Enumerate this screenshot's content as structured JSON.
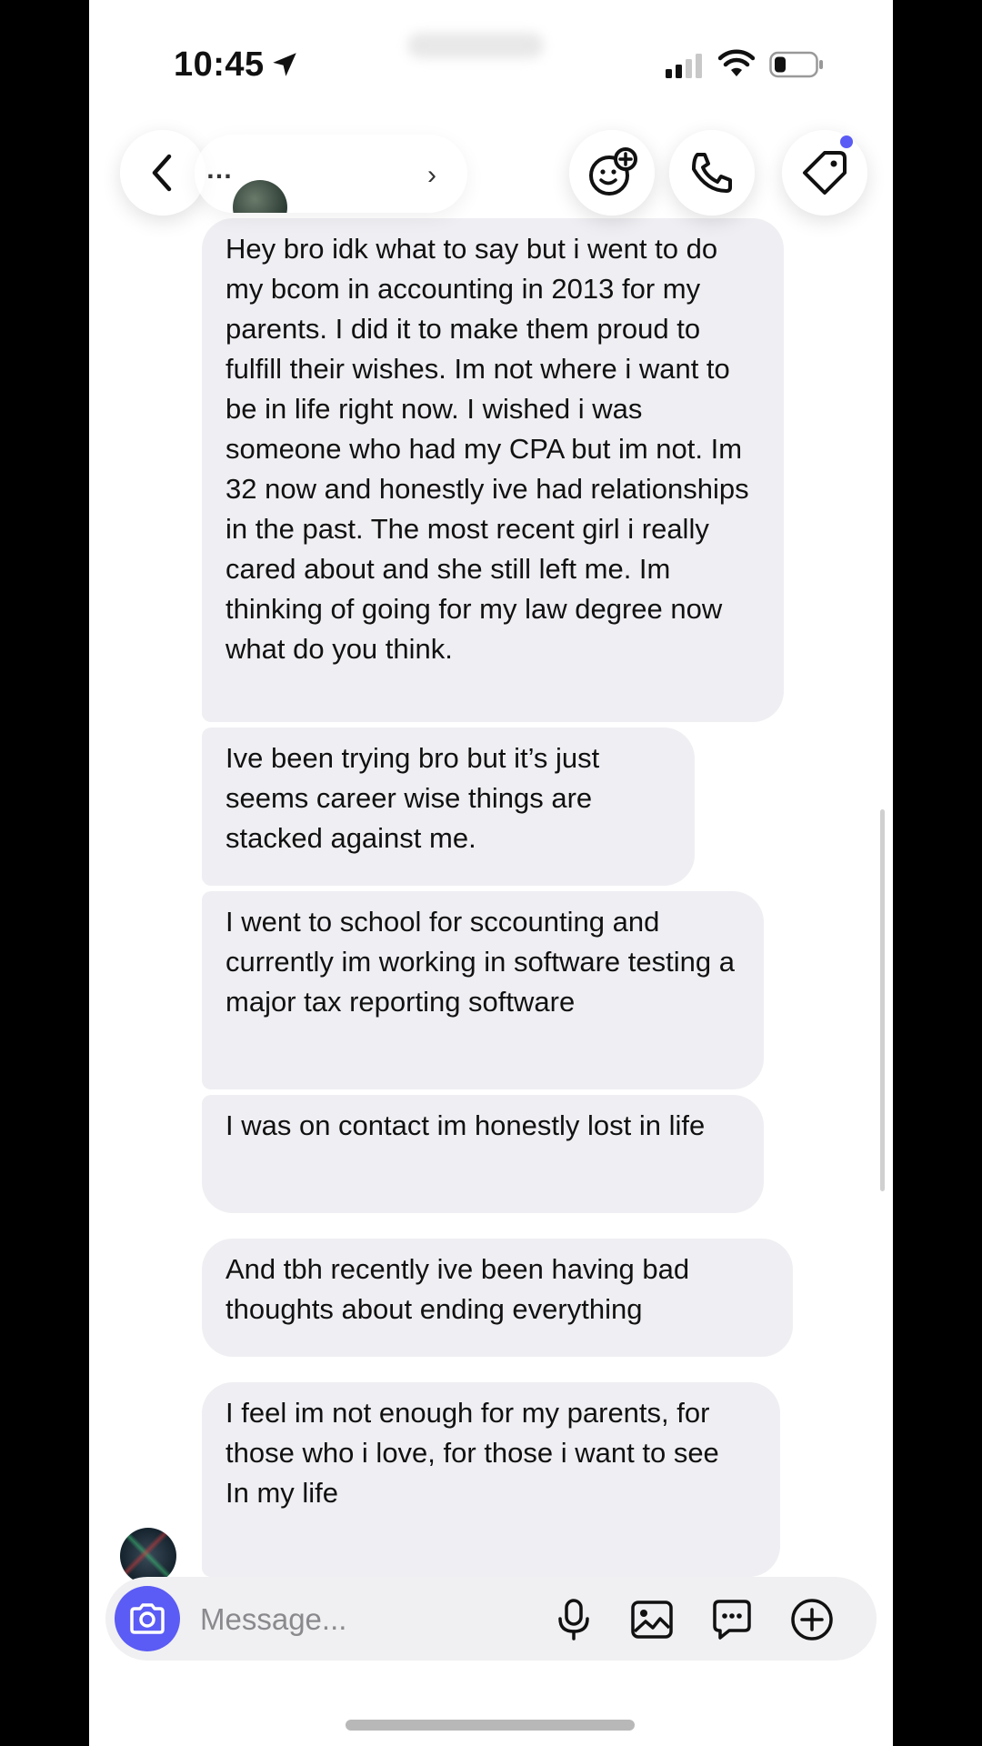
{
  "status_bar": {
    "time": "10:45",
    "icons": [
      "location-arrow-icon",
      "cellular-signal-icon",
      "wifi-icon",
      "battery-icon"
    ]
  },
  "header": {
    "contact_name": "…",
    "back_icon": "chevron-left-icon",
    "actions": [
      "add-effect-icon",
      "phone-icon",
      "tag-icon"
    ],
    "notification_dot_color": "#5b5bf5"
  },
  "messages": [
    {
      "text": "Hey bro idk what to say but i went to do my bcom in accounting in 2013 for my parents. I did it to make them proud to fulfill their wishes. Im not where i want to be in life right now. I wished i was someone who had my CPA but im not. Im 32 now and honestly ive had relationships in the past. The most recent girl i really cared about and she still left me. Im thinking of going for my law degree now what do you think."
    },
    {
      "text": "Ive been trying bro but it’s just seems career wise things are stacked against me."
    },
    {
      "text": "I went to school for sccounting and currently im working in software testing a major tax reporting software"
    },
    {
      "text": "I was on contact im honestly lost in life"
    },
    {
      "text": "And tbh recently ive been having bad thoughts about ending everything"
    },
    {
      "text": "I feel im not enough for my parents, for those who i love, for those i want to see\nIn my life"
    }
  ],
  "composer": {
    "placeholder": "Message...",
    "value": "",
    "camera_icon": "camera-icon",
    "actions": [
      "microphone-icon",
      "image-icon",
      "sticker-icon",
      "plus-circle-icon"
    ],
    "accent_color": "#5b5bf5"
  }
}
